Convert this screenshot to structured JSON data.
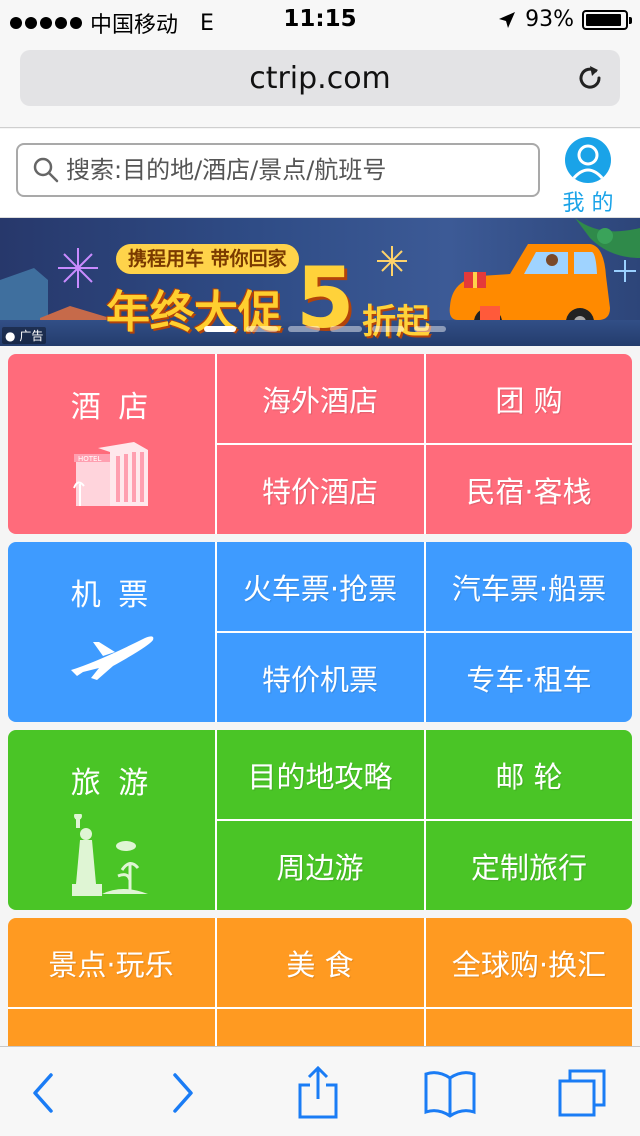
{
  "status_bar": {
    "carrier": "中国移动",
    "network": "E",
    "time": "11:15",
    "battery": "93%",
    "battery_level": 0.93,
    "icons": [
      "signal-dots-icon",
      "location-arrow-icon",
      "battery-icon"
    ]
  },
  "browser": {
    "url": "ctrip.com",
    "reload_icon": "reload-icon"
  },
  "search": {
    "placeholder": "搜索:目的地/酒店/景点/航班号",
    "icon": "search-icon",
    "mine_label": "我 的"
  },
  "banner": {
    "pill": "携程用车 带你回家",
    "title": "年终大促",
    "big_number": "5",
    "suffix": "折起",
    "ad_tag": "广告",
    "pages": 6,
    "active_page": 1
  },
  "grid": {
    "groups": [
      {
        "label": "酒 店",
        "color": "#ff6b7b",
        "icon": "hotel-building-icon",
        "items": [
          "海外酒店",
          "团 购",
          "特价酒店",
          "民宿·客栈"
        ]
      },
      {
        "label": "机 票",
        "color": "#3e9bff",
        "icon": "airplane-icon",
        "items": [
          "火车票·抢票",
          "汽车票·船票",
          "特价机票",
          "专车·租车"
        ]
      },
      {
        "label": "旅 游",
        "color": "#4ac526",
        "icon": "statue-of-liberty-icon",
        "items": [
          "目的地攻略",
          "邮 轮",
          "周边游",
          "定制旅行"
        ]
      },
      {
        "color": "#ff9a21",
        "items": [
          "景点·玩乐",
          "美 食",
          "全球购·换汇"
        ]
      }
    ]
  },
  "toolbar": {
    "buttons": [
      "back-icon",
      "forward-icon",
      "share-icon",
      "bookmarks-icon",
      "tabs-icon"
    ]
  }
}
